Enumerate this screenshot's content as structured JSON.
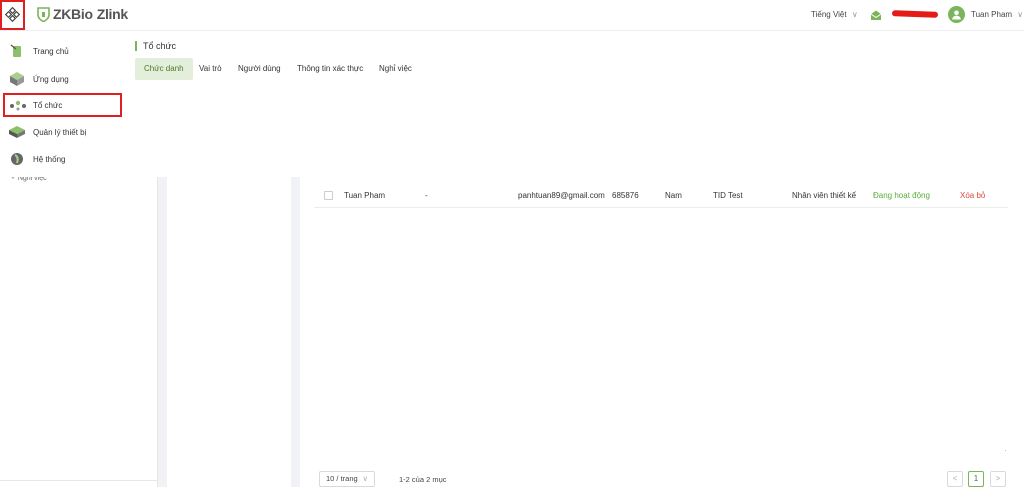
{
  "header": {
    "logo_brand": "ZKBio",
    "logo_product": "Zlink",
    "language": "Tiếng Việt",
    "user_name": "Tuan Pham"
  },
  "sidebar": {
    "items": [
      {
        "label": "Trang chủ",
        "icon": "home-icon"
      },
      {
        "label": "Ứng dụng",
        "icon": "apps-icon"
      },
      {
        "label": "Tổ chức",
        "icon": "organization-icon"
      },
      {
        "label": "Quản lý thiết bị",
        "icon": "device-icon"
      },
      {
        "label": "Hệ thống",
        "icon": "system-icon"
      }
    ]
  },
  "org_panel": {
    "title": "Tổ chức",
    "tabs": [
      "Chức danh",
      "Vai trò",
      "Người dùng",
      "Thông tin xác thực",
      "Nghỉ việc"
    ],
    "active_tab": "Chức danh"
  },
  "left_column": {
    "partial_item": "Nghỉ việc"
  },
  "table": {
    "rows": [
      {
        "name": "Tuan Pham",
        "col2": "-",
        "email": "panhtuan89@gmail.com",
        "code": "685876",
        "gender": "Nam",
        "company": "TID Test",
        "position": "Nhân viên thiết kế",
        "status": "Đang hoạt động",
        "action": "Xóa bỏ"
      }
    ]
  },
  "pagination": {
    "page_size": "10 / trang",
    "info": "1-2 của 2 mục",
    "current_page": "1",
    "prev": "<",
    "next": ">"
  },
  "colors": {
    "accent_green": "#7ab55c",
    "status_green": "#5aad3a",
    "danger_red": "#e0463b",
    "highlight_red": "#e02020"
  }
}
